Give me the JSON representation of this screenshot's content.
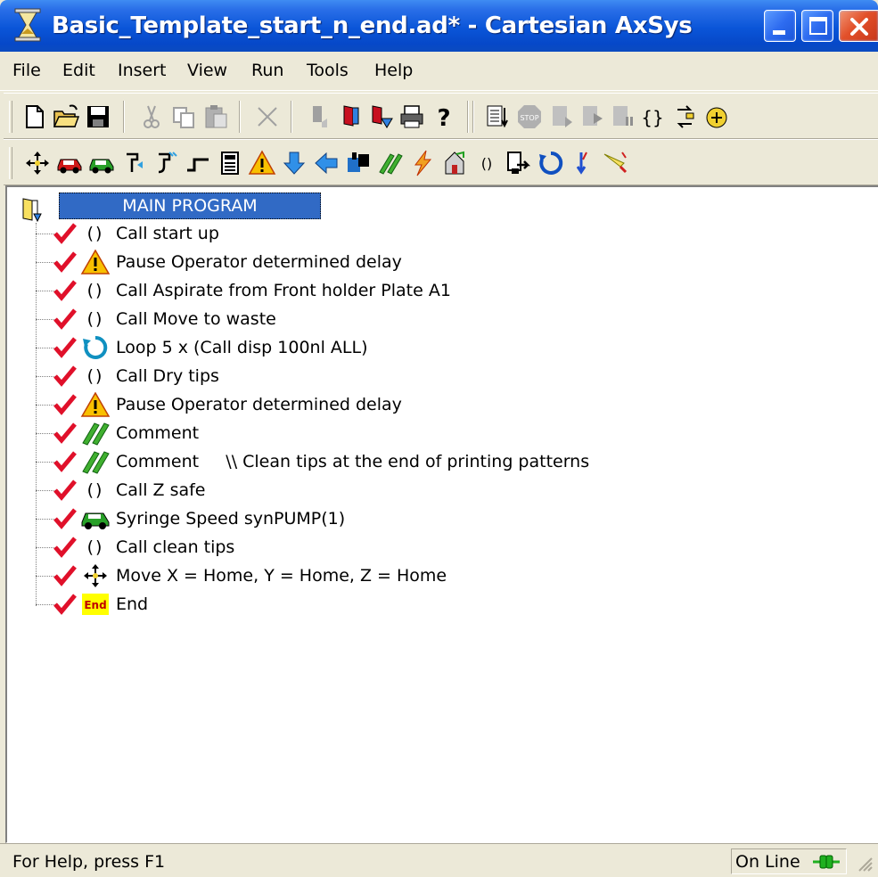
{
  "window": {
    "title": "Basic_Template_start_n_end.ad* - Cartesian AxSys",
    "app_icon": "hourglass-icon",
    "controls": [
      "minimize-icon",
      "maximize-icon",
      "close-icon"
    ],
    "title_bar_color": "#0A55D8"
  },
  "menu": {
    "items": [
      "File",
      "Edit",
      "Insert",
      "View",
      "Run",
      "Tools",
      "Help"
    ]
  },
  "toolbar_main": {
    "icons": [
      "new-file-icon",
      "open-folder-icon",
      "save-icon",
      "cut-icon",
      "copy-icon",
      "paste-icon",
      "delete-icon",
      "step-down-icon",
      "step-into-icon",
      "step-out-icon",
      "print-icon",
      "help-icon",
      "run-list-icon",
      "stop-icon",
      "step-icon",
      "continue-icon",
      "pause-icon",
      "variables-icon",
      "swap-icon",
      "settings-icon"
    ]
  },
  "toolbar_commands": {
    "icons": [
      "move-icon",
      "red-car-icon",
      "green-car-icon",
      "aspirate-icon",
      "dispense-icon",
      "wait-icon",
      "calculator-icon",
      "warning-icon",
      "down-arrow-icon",
      "left-arrow-icon",
      "valve-icon",
      "comment-icon",
      "lightning-icon",
      "home-icon",
      "call-icon",
      "output-icon",
      "loop-icon",
      "drop-icon",
      "pen-icon"
    ]
  },
  "tree": {
    "root_label": "MAIN PROGRAM",
    "items": [
      {
        "icon": "call-icon",
        "label": "Call start up"
      },
      {
        "icon": "warning-icon",
        "label": "Pause Operator determined delay"
      },
      {
        "icon": "call-icon",
        "label": "Call Aspirate from Front holder Plate A1"
      },
      {
        "icon": "call-icon",
        "label": "Call Move to waste"
      },
      {
        "icon": "loop-icon",
        "label": "Loop 5 x (Call disp 100nl ALL)"
      },
      {
        "icon": "call-icon",
        "label": "Call Dry tips"
      },
      {
        "icon": "warning-icon",
        "label": "Pause Operator determined delay"
      },
      {
        "icon": "comment-icon",
        "label": "Comment"
      },
      {
        "icon": "comment-icon",
        "label": "Comment     \\\\ Clean tips at the end of printing patterns"
      },
      {
        "icon": "call-icon",
        "label": "Call Z safe"
      },
      {
        "icon": "syringe-car-icon",
        "label": "Syringe Speed synPUMP(1)"
      },
      {
        "icon": "call-icon",
        "label": "Call clean tips"
      },
      {
        "icon": "move-icon",
        "label": "Move X = Home, Y = Home, Z = Home"
      },
      {
        "icon": "end-icon",
        "label": "End",
        "icon_text": "End"
      }
    ],
    "check_color": "#E0102A"
  },
  "status": {
    "help_text": "For Help, press F1",
    "online_text": "On Line",
    "online_icon": "plug-icon"
  }
}
